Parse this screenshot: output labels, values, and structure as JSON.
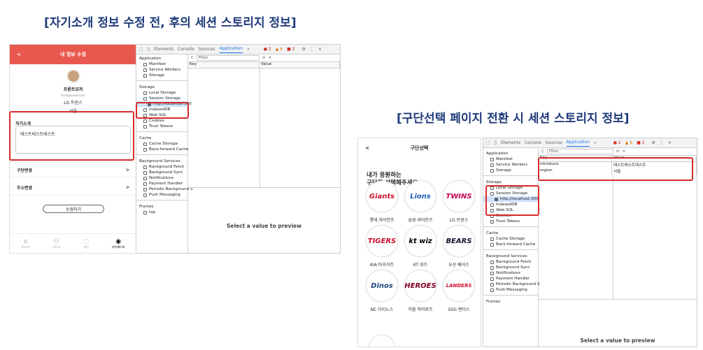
{
  "titles": {
    "left": "[자기소개 정보 수정 전, 후의 세션 스토리지 정보]",
    "right": "[구단선택 페이지 전환 시 세션 스토리지 정보]"
  },
  "devtools": {
    "tabs": [
      "Elements",
      "Console",
      "Sources",
      "Application",
      "»"
    ],
    "active_tab": "Application",
    "errors": "2",
    "warnings": "6",
    "issues": "2",
    "filter_placeholder": "Filter",
    "col_key": "Key",
    "col_value": "Value",
    "preview_text": "Select a value to preview",
    "sections": {
      "application": {
        "header": "Application",
        "items": [
          "Manifest",
          "Service Workers",
          "Storage"
        ]
      },
      "storage": {
        "header": "Storage",
        "local": "Local Storage",
        "session": "Session Storage",
        "session_child": "http://localhost:300",
        "indexeddb": "IndexedDB",
        "websql": "Web SQL",
        "cookies": "Cookies",
        "trust": "Trust Tokens"
      },
      "cache": {
        "header": "Cache",
        "items": [
          "Cache Storage",
          "Back-forward Cache"
        ]
      },
      "bg": {
        "header": "Background Services",
        "items": [
          "Background Fetch",
          "Background Sync",
          "Notifications",
          "Payment Handler",
          "Periodic Background S",
          "Push Messaging"
        ]
      },
      "frames": {
        "header": "Frames",
        "items": [
          "top"
        ]
      }
    },
    "session_rows": [
      {
        "key": "introduce",
        "value": "테스트테스트테스트"
      },
      {
        "key": "region",
        "value": "서울"
      }
    ]
  },
  "profile": {
    "header_title": "내 정보 수정",
    "back": "<",
    "nickname": "프론트요저",
    "email": "front@naver.com",
    "team": "LG 트윈스",
    "region": "서울",
    "intro_label": "자기소개",
    "intro_value": "테스트테스트테스트",
    "change_team": "구단변경",
    "change_address": "주소변경",
    "chevron": ">",
    "submit": "수정하기",
    "nav": [
      "Home",
      "라이브",
      "채팅",
      "마이페이지"
    ]
  },
  "team_select": {
    "back": "<",
    "header_title": "구단선택",
    "heading_line1": "내가 응원하는",
    "heading_line2": "구단을 선택해주세요.",
    "teams": [
      {
        "name": "롯데 자이언츠",
        "logo": "Giants",
        "color": "#d0112b"
      },
      {
        "name": "삼성 라이온즈",
        "logo": "Lions",
        "color": "#1f5fb8"
      },
      {
        "name": "LG 트윈스",
        "logo": "TWINS",
        "color": "#c30452"
      },
      {
        "name": "KIA 타이거즈",
        "logo": "TIGERS",
        "color": "#c8102e"
      },
      {
        "name": "KT 위즈",
        "logo": "kt wiz",
        "color": "#000000"
      },
      {
        "name": "두산 베어스",
        "logo": "BEARS",
        "color": "#131230"
      },
      {
        "name": "NC 다이노스",
        "logo": "Dinos",
        "color": "#1d467f"
      },
      {
        "name": "키움 히어로즈",
        "logo": "HEROES",
        "color": "#820024"
      },
      {
        "name": "SSG 랜더스",
        "logo": "LANDERS",
        "color": "#ce0e2d"
      }
    ]
  }
}
